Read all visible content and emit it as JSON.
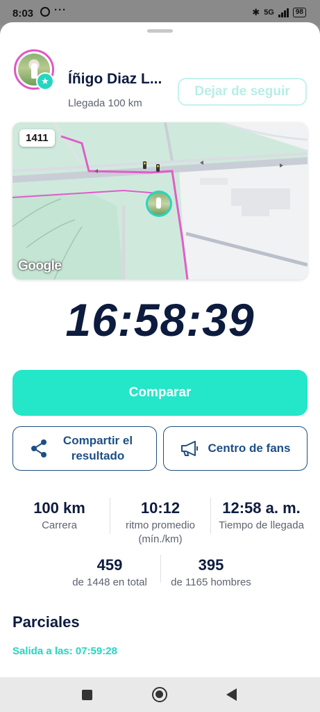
{
  "status_bar": {
    "time": "8:03",
    "more": "···",
    "bluetooth": "✱",
    "network": "5G",
    "battery": "98"
  },
  "runner": {
    "name": "Íñigo Diaz L...",
    "status": "Llegada 100 km",
    "unfollow_label": "Dejar de seguir"
  },
  "map": {
    "bib_number": "1411",
    "attribution": "Google",
    "colors": {
      "park": "#cfe9dc",
      "route": "#e25cc9",
      "road": "#c9ced6"
    }
  },
  "result": {
    "final_time": "16:58:39"
  },
  "actions": {
    "compare_label": "Comparar",
    "share_label": "Compartir el resultado",
    "fans_label": "Centro de fans"
  },
  "stats": {
    "distance": {
      "value": "100 km",
      "label": "Carrera"
    },
    "pace": {
      "value": "10:12",
      "label": "ritmo promedio (mín./km)"
    },
    "arrival": {
      "value": "12:58 a. m.",
      "label": "Tiempo de llegada"
    },
    "overall": {
      "value": "459",
      "label": "de 1448 en total"
    },
    "gender": {
      "value": "395",
      "label": "de 1165 hombres"
    }
  },
  "splits": {
    "title": "Parciales",
    "start": "Salida a las: 07:59:28"
  },
  "colors": {
    "accent": "#24e6c8",
    "navy": "#0d1b3e",
    "outline": "#1d4f86"
  }
}
